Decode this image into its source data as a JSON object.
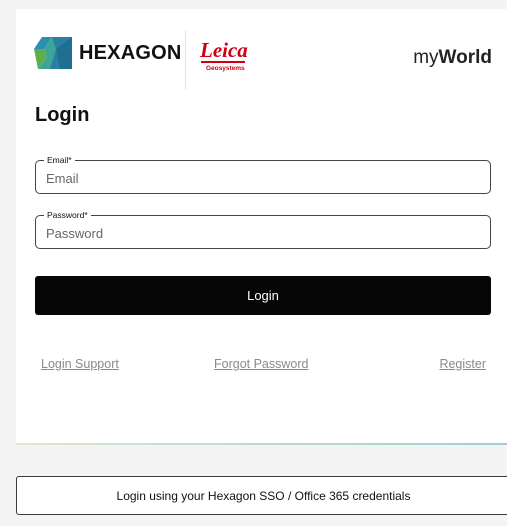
{
  "brand": {
    "company": "HEXAGON",
    "leica_word": "Leica",
    "leica_sub": "Geosystems",
    "app_name_light": "my",
    "app_name_bold": "World"
  },
  "login": {
    "heading": "Login",
    "email_label": "Email*",
    "email_placeholder": "Email",
    "password_label": "Password*",
    "password_placeholder": "Password",
    "submit_label": "Login"
  },
  "links": {
    "support": "Login Support",
    "forgot": "Forgot Password",
    "register": "Register"
  },
  "sso": {
    "label": "Login using your Hexagon SSO / Office 365 credentials"
  },
  "colors": {
    "leica_red": "#d00012",
    "button_black": "#060606",
    "link_gray": "#8a8a8a"
  },
  "icons": [
    "hexagon-logo-icon",
    "leica-logo"
  ]
}
